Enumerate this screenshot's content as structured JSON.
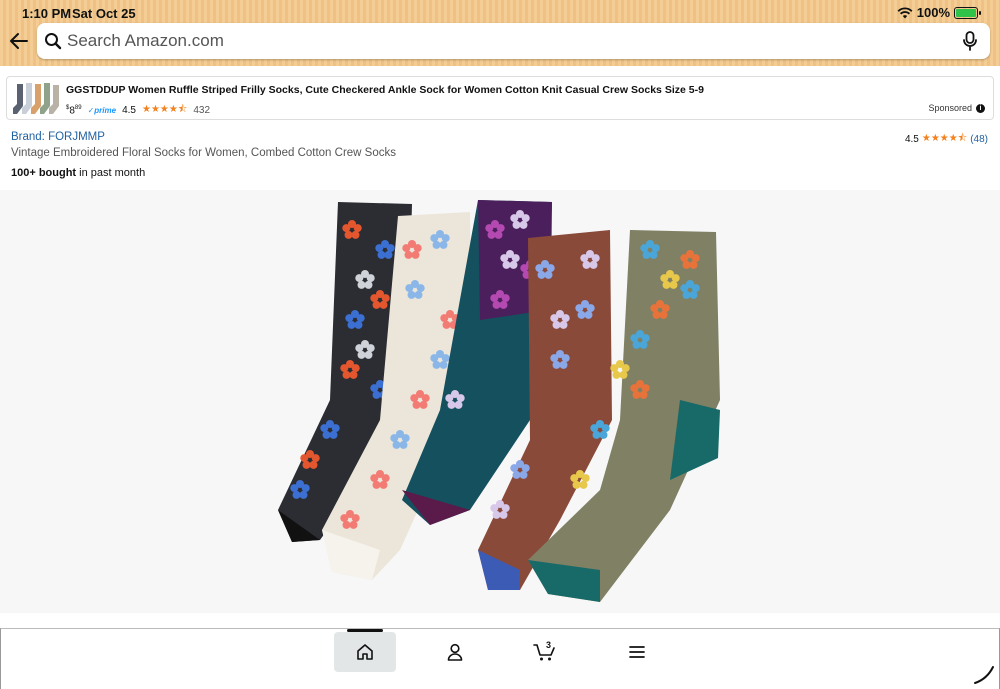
{
  "status_bar": {
    "time": "1:10 PM",
    "date": "Sat Oct 25",
    "battery": "100%"
  },
  "search": {
    "placeholder": "Search Amazon.com"
  },
  "sponsored_ad": {
    "title": "GGSTDDUP Women Ruffle Striped Frilly Socks, Cute Checkered Ankle Sock for Women Cotton Knit Casual Crew Socks Size 5-9",
    "price_symbol": "$",
    "price_whole": "8",
    "price_fraction": "89",
    "prime_label": "prime",
    "rating": "4.5",
    "stars": "★★★★⯪",
    "review_count": "432",
    "sponsored_label": "Sponsored",
    "info_glyph": "i"
  },
  "product": {
    "brand": "Brand: FORJMMP",
    "rating": "4.5",
    "stars": "★★★★⯪",
    "review_count": "(48)",
    "title": "Vintage Embroidered Floral Socks for Women, Combed Cotton Crew Socks",
    "bought_bold": "100+ bought",
    "bought_rest": " in past month"
  },
  "tab_bar": {
    "tabs": [
      {
        "name": "home",
        "icon": "home-icon",
        "active": true
      },
      {
        "name": "account",
        "icon": "person-icon",
        "active": false
      },
      {
        "name": "cart",
        "icon": "cart-icon",
        "active": false,
        "count": "3"
      },
      {
        "name": "menu",
        "icon": "menu-icon",
        "active": false
      }
    ]
  },
  "colors": {
    "header_bg": "#f3cd94",
    "link": "#2162a1",
    "star": "#f3811e",
    "prime": "#1a98ff"
  }
}
